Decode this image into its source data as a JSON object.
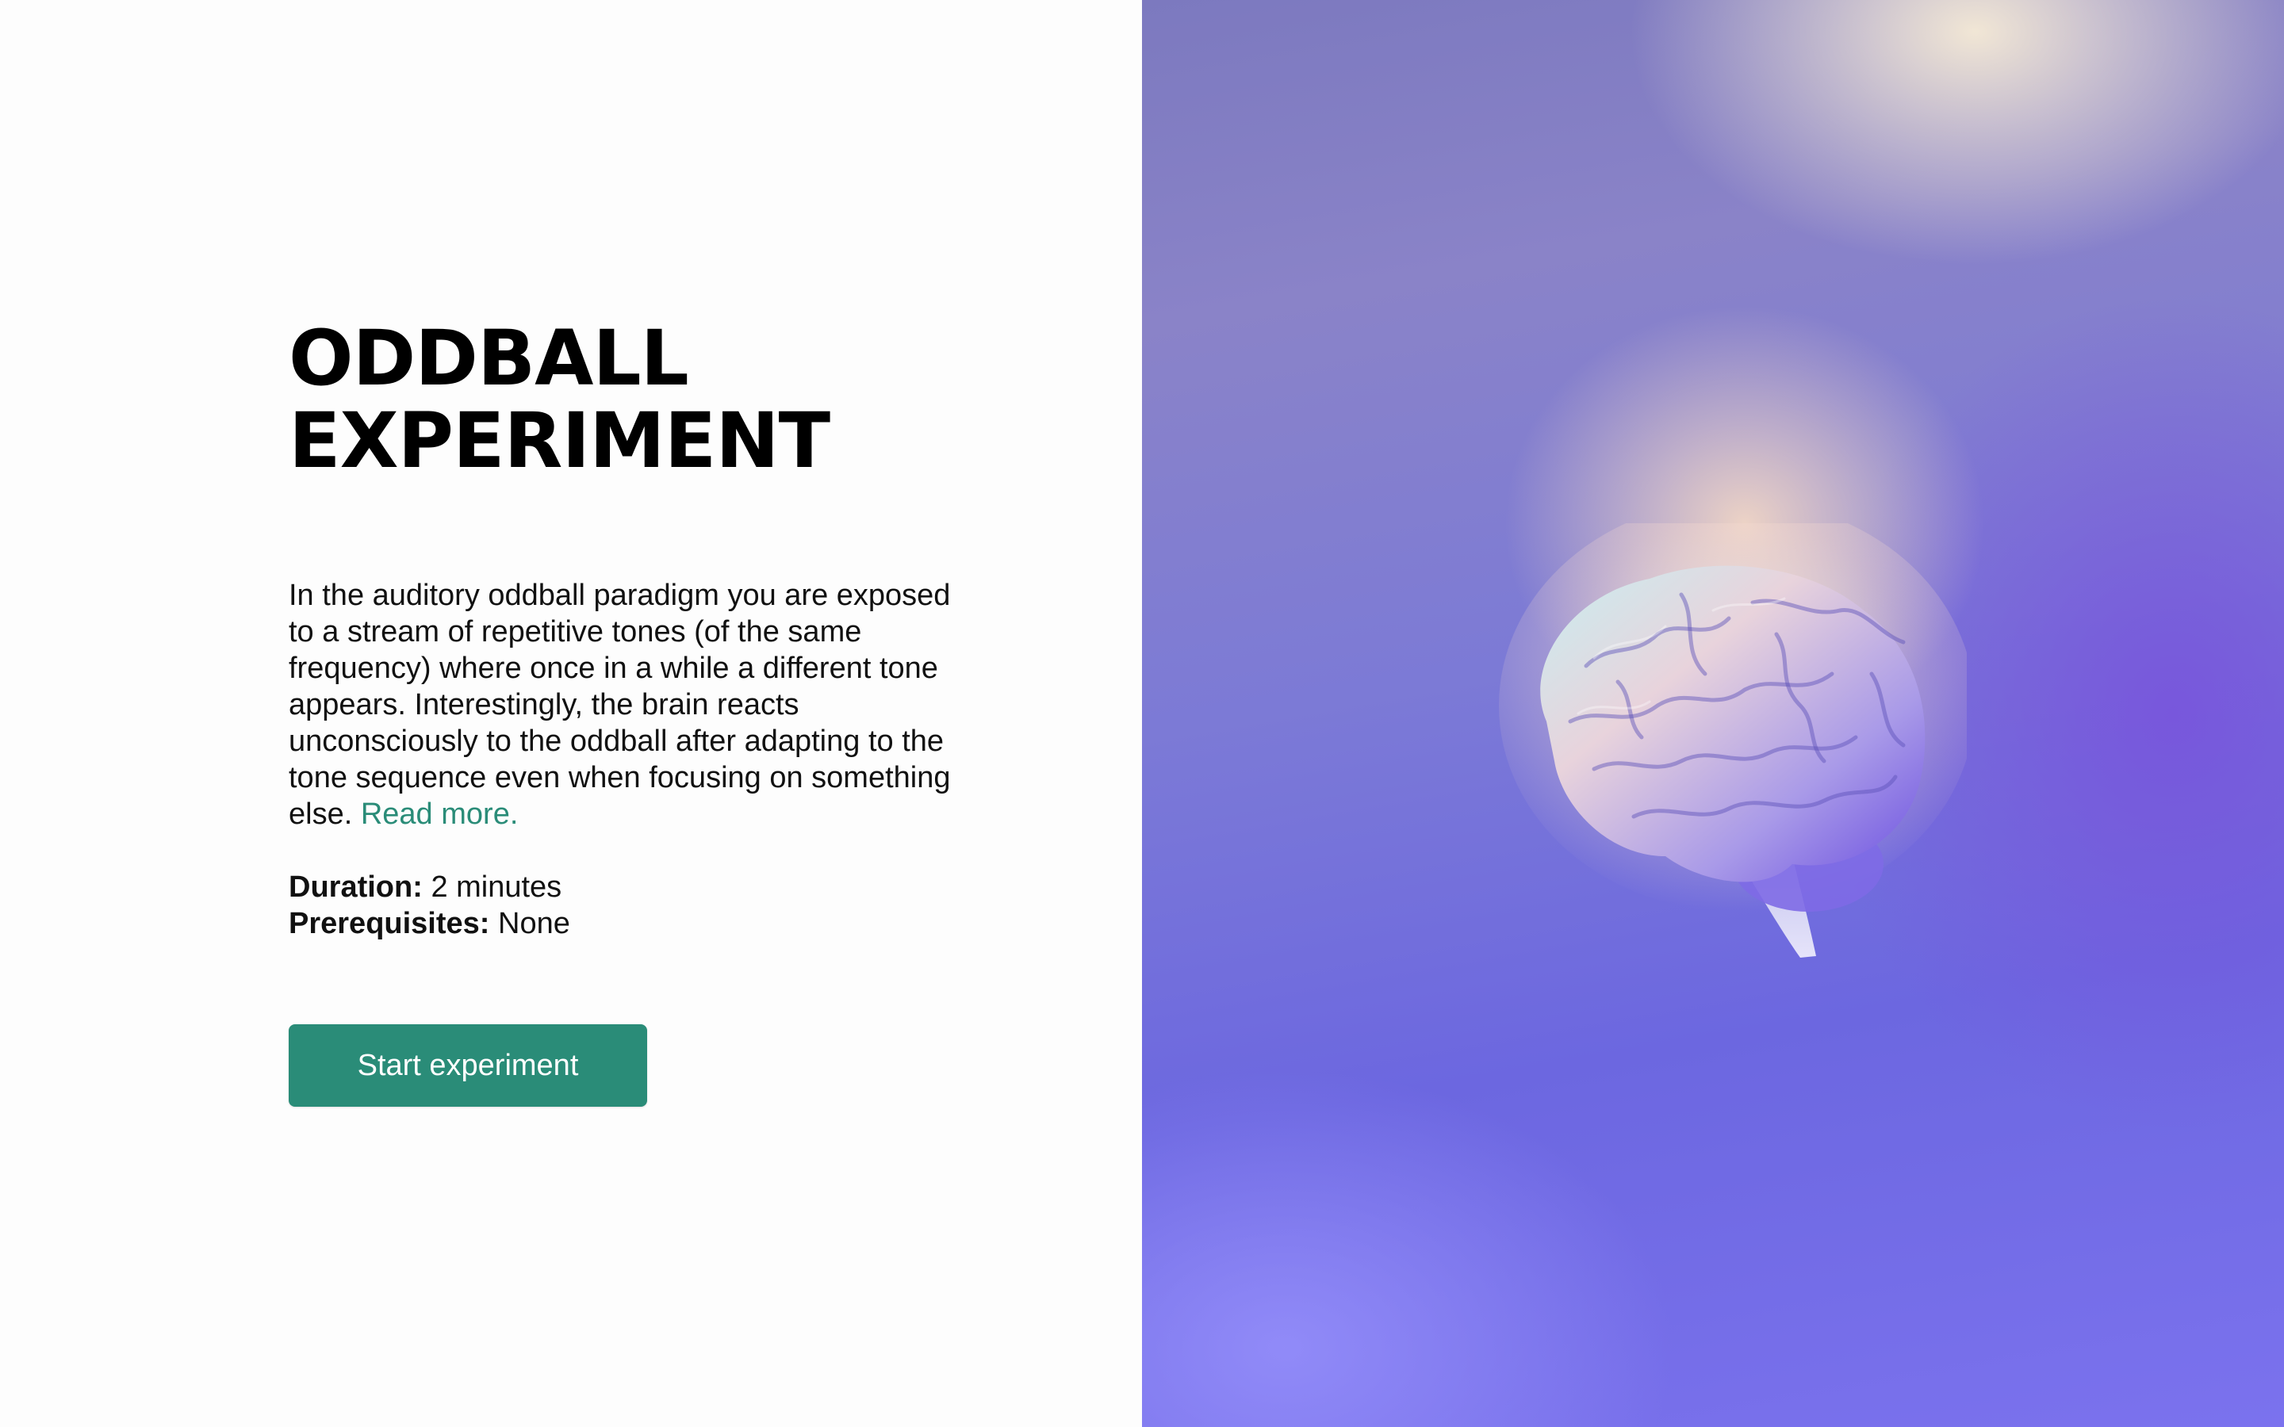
{
  "experiment": {
    "title_line1": "ODDBALL",
    "title_line2": "EXPERIMENT",
    "description": "In the auditory oddball paradigm you are exposed to a stream of repetitive tones (of the same frequency) where once in a while a different tone appears. Interestingly, the brain reacts unconsciously to the oddball after adapting to the tone sequence even when focusing on something else.",
    "read_more": "Read more.",
    "duration_label": "Duration:",
    "duration_value": "2 minutes",
    "prerequisites_label": "Prerequisites:",
    "prerequisites_value": "None",
    "start_button": "Start experiment"
  },
  "hero": {
    "image_icon": "brain-icon"
  },
  "colors": {
    "accent": "#2a8c78",
    "heading": "#000000",
    "text": "#111111"
  }
}
